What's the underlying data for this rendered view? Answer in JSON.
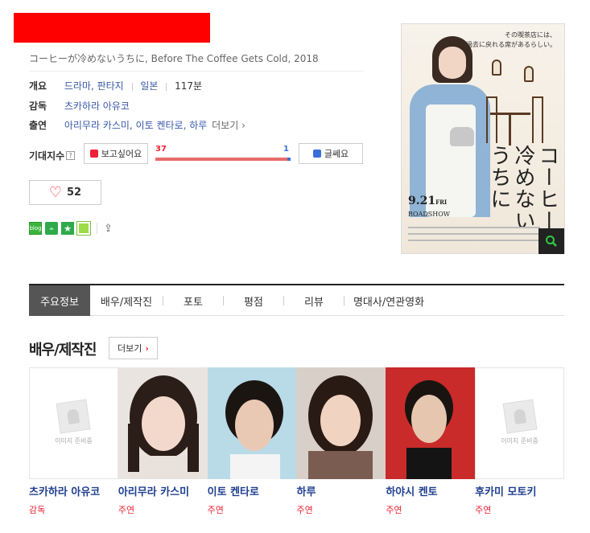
{
  "movie": {
    "subtitle": "コーヒーが冷めないうちに, Before The Coffee Gets Cold, 2018",
    "info": {
      "overview_label": "개요",
      "genres": "드라마, 판타지",
      "country": "일본",
      "runtime": "117분",
      "director_label": "감독",
      "director": "츠카하라 아유코",
      "cast_label": "출연",
      "cast": "아리무라 카스미, 이토 켄타로, 하루",
      "more": "더보기"
    },
    "expectation": {
      "label": "기대지수",
      "help": "?",
      "want_label": "보고싶어요",
      "want_count": "37",
      "no_count": "1",
      "want_ratio": 0.974,
      "no_label": "글쎄요"
    },
    "like_count": "52"
  },
  "poster": {
    "tagline_line1": "その喫茶店には、",
    "tagline_line2": "過去に戻れる席があるらしい。",
    "title_col1": "コーヒーが",
    "title_col2": "冷めない",
    "title_col3": "うちに",
    "release_date": "9.21",
    "release_day": "FRI",
    "roadshow": "ROADSHOW"
  },
  "share": {
    "blog_label": "blog"
  },
  "tabs": [
    {
      "label": "주요정보",
      "active": true
    },
    {
      "label": "배우/제작진",
      "active": false
    },
    {
      "label": "포토",
      "active": false
    },
    {
      "label": "평점",
      "active": false
    },
    {
      "label": "리뷰",
      "active": false
    },
    {
      "label": "명대사/연관영화",
      "active": false
    }
  ],
  "cast_section": {
    "title": "배우/제작진",
    "more_label": "더보기",
    "placeholder_text": "이미지 준비중",
    "people": [
      {
        "name": "츠카하라 아유코",
        "role": "감독",
        "has_photo": false
      },
      {
        "name": "아리무라 카스미",
        "role": "주연",
        "has_photo": true
      },
      {
        "name": "이토 켄타로",
        "role": "주연",
        "has_photo": true
      },
      {
        "name": "하루",
        "role": "주연",
        "has_photo": true
      },
      {
        "name": "하야시 켄토",
        "role": "주연",
        "has_photo": true
      },
      {
        "name": "후카미 모토키",
        "role": "주연",
        "has_photo": false
      }
    ]
  },
  "colors": {
    "link_blue": "#3a59a8",
    "name_blue": "#1f3f8f",
    "accent_red": "#ee2233",
    "vote_blue": "#3a6fd8"
  }
}
